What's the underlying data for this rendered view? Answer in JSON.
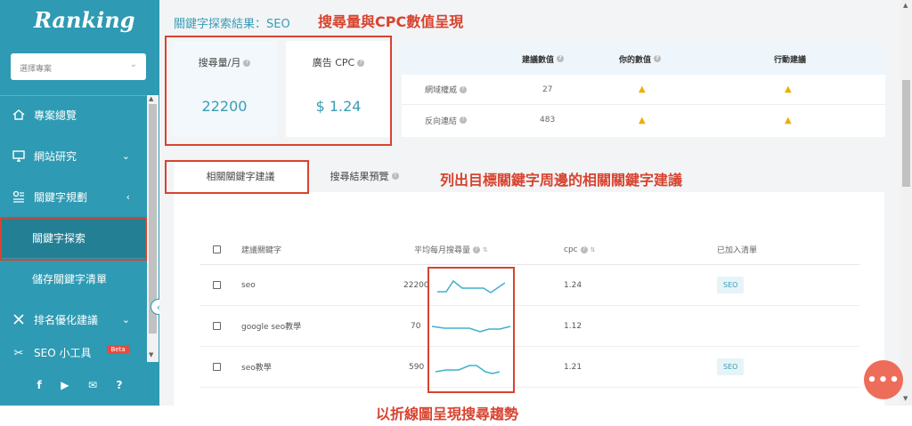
{
  "sidebar": {
    "logo": "Ranking",
    "project_select_placeholder": "選擇專案",
    "items": [
      {
        "label": "專案總覽",
        "icon": "home-icon"
      },
      {
        "label": "網站研究",
        "icon": "monitor-icon",
        "arrow": "⌄"
      },
      {
        "label": "關鍵字規劃",
        "icon": "keyword-icon",
        "arrow": "‹"
      },
      {
        "label": "排名優化建議",
        "icon": "tools-icon",
        "arrow": "⌄"
      }
    ],
    "sub_items": [
      {
        "label": "關鍵字探索",
        "active": true
      },
      {
        "label": "儲存關鍵字清單",
        "active": false
      }
    ],
    "partial_item": "SEO 小工具",
    "partial_badge": "Beta",
    "social": [
      "f",
      "▶",
      "✉",
      "?"
    ]
  },
  "main": {
    "breadcrumb": "關鍵字探索結果：SEO",
    "metrics": [
      {
        "label": "搜尋量/月",
        "value": "22200"
      },
      {
        "label": "廣告 CPC",
        "value": "$ 1.24"
      }
    ],
    "authority_table": {
      "headers": [
        "建議數值",
        "你的數值",
        "行動建議"
      ],
      "rows": [
        {
          "label": "網域權威",
          "suggested": "27"
        },
        {
          "label": "反向連結",
          "suggested": "483"
        }
      ]
    },
    "tabs": [
      "相關關鍵字建議",
      "搜尋結果預覽"
    ],
    "keyword_table": {
      "headers": [
        "建議關鍵字",
        "平均每月搜尋量",
        "cpc",
        "已加入清單"
      ],
      "rows": [
        {
          "keyword": "seo",
          "volume": "22200",
          "cpc": "1.24",
          "tag": "SEO"
        },
        {
          "keyword": "google seo教學",
          "volume": "70",
          "cpc": "1.12",
          "tag": ""
        },
        {
          "keyword": "seo教學",
          "volume": "590",
          "cpc": "1.21",
          "tag": "SEO"
        }
      ]
    }
  },
  "annotations": {
    "top": "搜尋量與CPC數值呈現",
    "middle": "列出目標關鍵字周邊的相關關鍵字建議",
    "bottom": "以折線圖呈現搜尋趨勢"
  },
  "colors": {
    "accent": "#2e9ab3",
    "annotation": "#d8432f",
    "warning": "#f0ad00"
  }
}
